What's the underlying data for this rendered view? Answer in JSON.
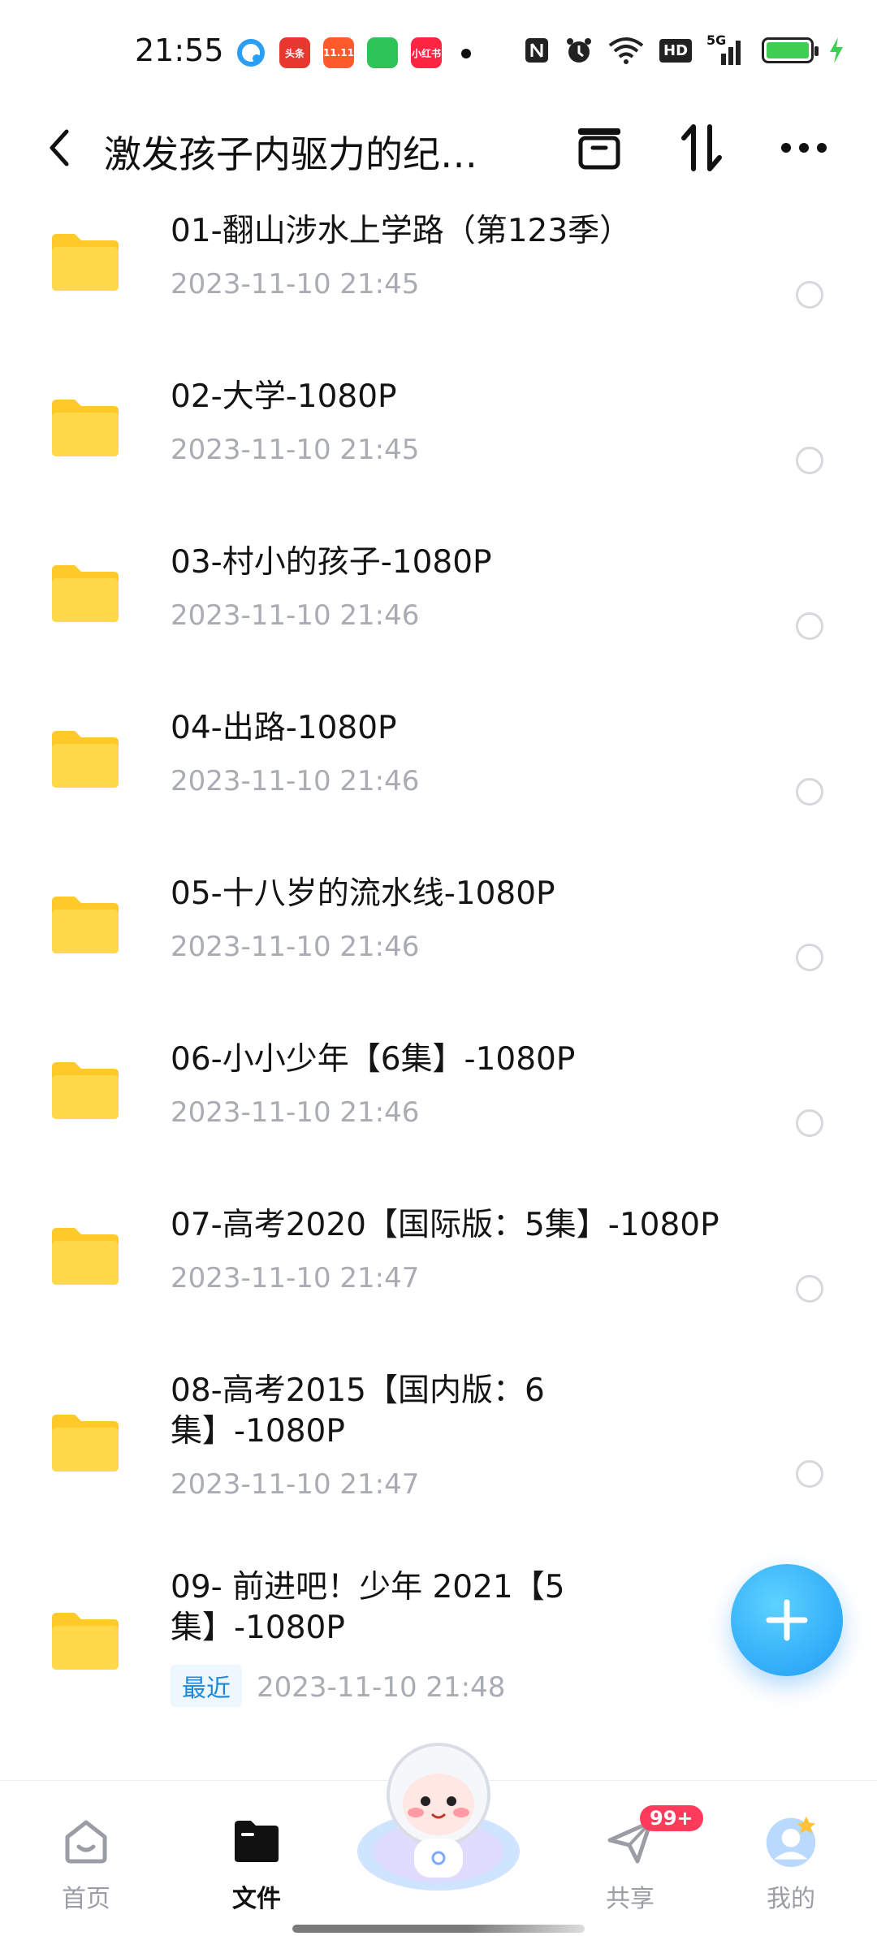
{
  "status_bar": {
    "time": "21:55",
    "app_icons": [
      "browser-icon",
      "toutiao-icon",
      "shopping-icon",
      "green-app-icon",
      "xiaohongshu-icon"
    ],
    "app_labels": [
      "",
      "头条",
      "11.11",
      "",
      "小红书"
    ],
    "right_icons": [
      "nfc-icon",
      "alarm-icon",
      "wifi-icon",
      "hd-icon",
      "5g-signal-icon",
      "battery-icon"
    ],
    "hd_label": "HD",
    "signal_label": "5G"
  },
  "header": {
    "title": "激发孩子内驱力的纪…",
    "icons": [
      "archive-icon",
      "sort-icon",
      "more-icon"
    ]
  },
  "files": [
    {
      "name": "01-翻山涉水上学路（第123季）",
      "date": "2023-11-10  21:45"
    },
    {
      "name": "02-大学-1080P",
      "date": "2023-11-10  21:45"
    },
    {
      "name": "03-村小的孩子-1080P",
      "date": "2023-11-10  21:46"
    },
    {
      "name": "04-出路-1080P",
      "date": "2023-11-10  21:46"
    },
    {
      "name": "05-十八岁的流水线-1080P",
      "date": "2023-11-10  21:46"
    },
    {
      "name": "06-小小少年【6集】-1080P",
      "date": "2023-11-10  21:46"
    },
    {
      "name": "07-高考2020【国际版：5集】-1080P",
      "date": "2023-11-10  21:47"
    },
    {
      "name": "08-高考2015【国内版：6集】-1080P",
      "date": "2023-11-10  21:47"
    },
    {
      "name": "09- 前进吧！少年 2021【5集】-1080P",
      "date": "2023-11-10  21:48",
      "badge": "最近"
    }
  ],
  "fab": {
    "icon": "plus-icon"
  },
  "bottom_nav": {
    "items": [
      {
        "label": "首页",
        "icon": "home-icon"
      },
      {
        "label": "文件",
        "icon": "folder-icon",
        "active": true
      },
      {
        "label": "",
        "icon": "mascot-icon"
      },
      {
        "label": "共享",
        "icon": "paper-plane-icon",
        "badge": "99+"
      },
      {
        "label": "我的",
        "icon": "avatar-icon"
      }
    ]
  },
  "colors": {
    "folder": "#ffd43a",
    "accent_blue": "#1d9bf5",
    "badge_red": "#ff3b5c",
    "meta_gray": "#a9acb3"
  }
}
